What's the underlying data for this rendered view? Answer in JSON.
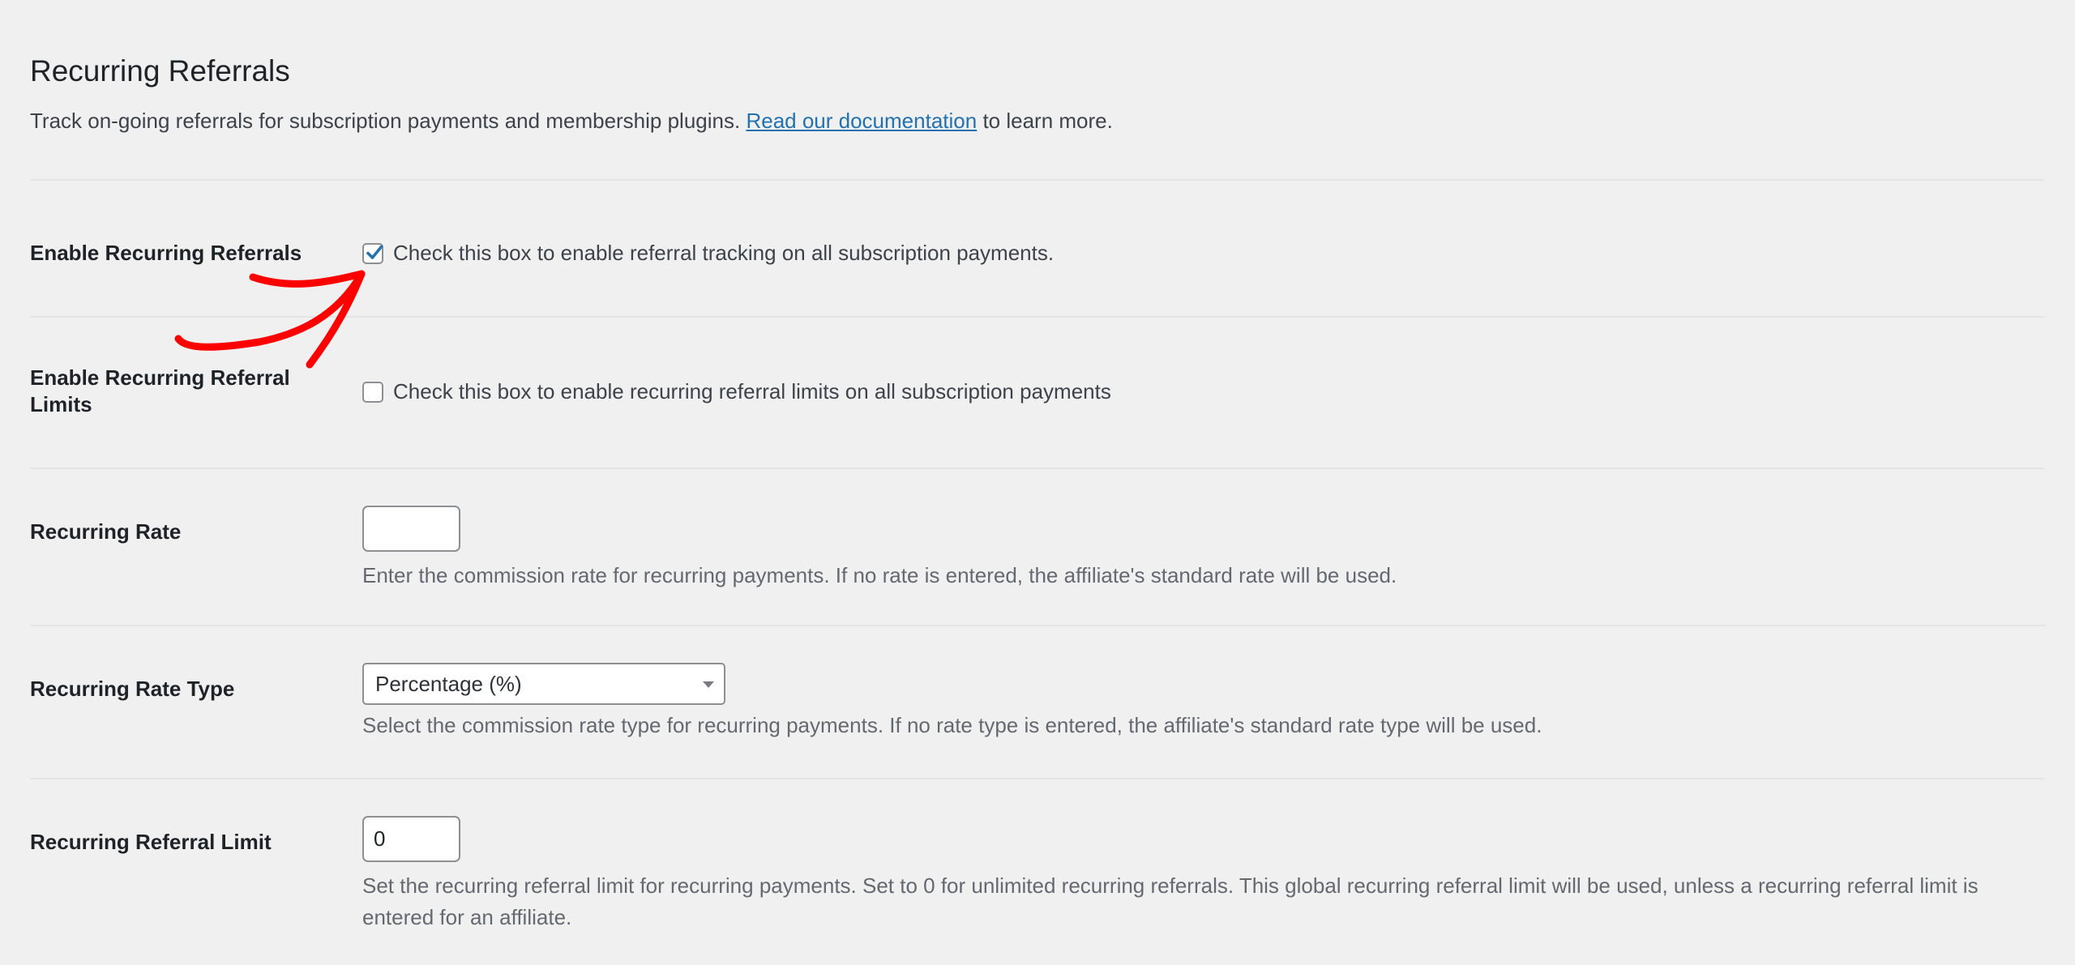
{
  "header": {
    "title": "Recurring Referrals",
    "description_before": "Track on-going referrals for subscription payments and membership plugins.",
    "doc_link": "Read our documentation",
    "description_after": "to learn more."
  },
  "rows": {
    "enable_recurring": {
      "label": "Enable Recurring Referrals",
      "checked": true,
      "checkbox_text": "Check this box to enable referral tracking on all subscription payments."
    },
    "enable_limits": {
      "label": "Enable Recurring Referral Limits",
      "checked": false,
      "checkbox_text": "Check this box to enable recurring referral limits on all subscription payments"
    },
    "recurring_rate": {
      "label": "Recurring Rate",
      "value": "",
      "help": "Enter the commission rate for recurring payments. If no rate is entered, the affiliate's standard rate will be used."
    },
    "recurring_rate_type": {
      "label": "Recurring Rate Type",
      "selected": "Percentage (%)",
      "help": "Select the commission rate type for recurring payments. If no rate type is entered, the affiliate's standard rate type will be used."
    },
    "recurring_limit": {
      "label": "Recurring Referral Limit",
      "value": "0",
      "help": "Set the recurring referral limit for recurring payments. Set to 0 for unlimited recurring referrals. This global recurring referral limit will be used, unless a recurring referral limit is entered for an affiliate."
    }
  },
  "colors": {
    "background": "#f0f0f1",
    "link": "#2271b1",
    "checkmark": "#2271b1",
    "annotation": "#ff0000"
  },
  "icons": {
    "check": "checkmark-icon",
    "select_arrow": "chevron-down-icon",
    "annotation": "hand-drawn-arrow-icon"
  }
}
